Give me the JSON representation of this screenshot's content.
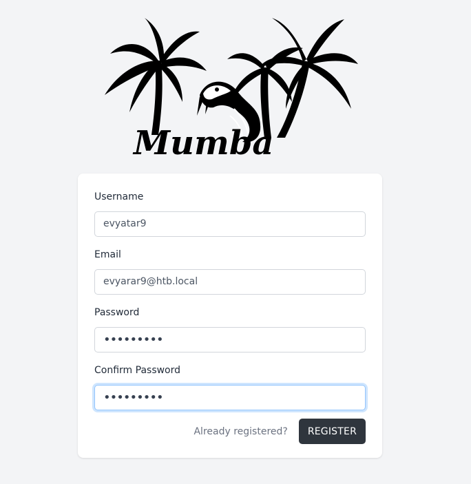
{
  "logo": {
    "brand_text": "Mumba",
    "icon": "palm-trees-snake-logo"
  },
  "form": {
    "username": {
      "label": "Username",
      "value": "evyatar9"
    },
    "email": {
      "label": "Email",
      "value": "evyarar9@htb.local"
    },
    "password": {
      "label": "Password",
      "masked_value": "•••••••••"
    },
    "confirm_password": {
      "label": "Confirm Password",
      "masked_value": "•••••••••",
      "focused": true
    },
    "already_registered_link": "Already registered?",
    "register_button": "REGISTER"
  },
  "colors": {
    "page_bg": "#f3f4f6",
    "card_bg": "#ffffff",
    "button_bg": "#2f353d",
    "focus_ring": "#93c5fd"
  }
}
